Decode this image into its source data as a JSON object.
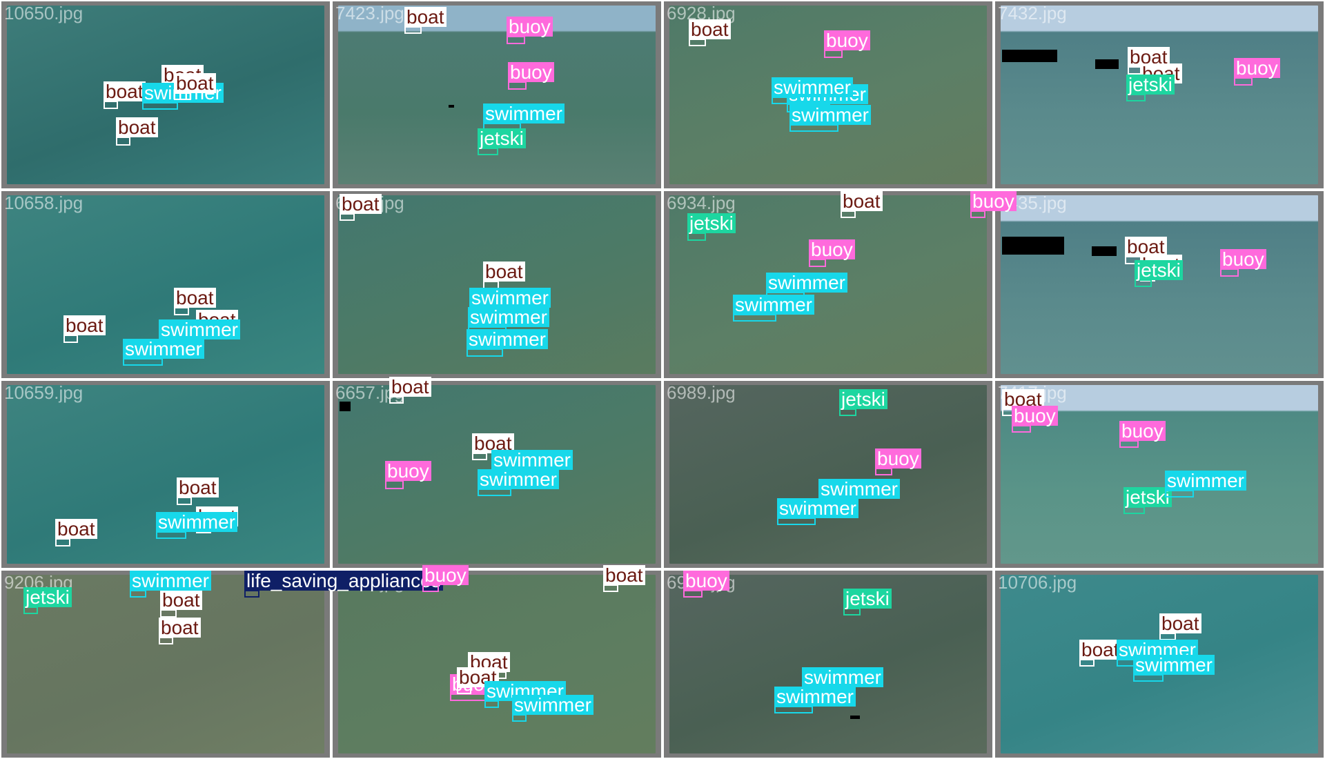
{
  "classes": {
    "boat": {
      "bg": "#ffffff",
      "fg": "#6b1a12"
    },
    "buoy": {
      "bg": "#ff6adc",
      "fg": "#ffffff"
    },
    "swimmer": {
      "bg": "#17d8ea",
      "fg": "#ffffff"
    },
    "jetski": {
      "bg": "#1dd6a0",
      "fg": "#ffffff"
    },
    "life_saving_appliances": {
      "bg": "#0f1f66",
      "fg": "#ffffff"
    }
  },
  "tiles": [
    {
      "name": "10650.jpg",
      "water": [
        "#3e7d7a",
        "#2f6d6c",
        "#3a7e7c"
      ],
      "sky": "",
      "frame": "#7a7a7a",
      "detections": [
        {
          "cls": "boat",
          "label": "boat"
        },
        {
          "cls": "boat",
          "label": "boat"
        },
        {
          "cls": "swimmer",
          "label": "swimmer"
        },
        {
          "cls": "boat",
          "label": "boat"
        },
        {
          "cls": "boat",
          "label": "boat"
        }
      ]
    },
    {
      "name": "7423.jpg",
      "water": [
        "#4d7b73",
        "#4a7a6b",
        "#5a8073"
      ],
      "sky": "#8fb3c8",
      "frame": "#7a7a7a",
      "detections": [
        {
          "cls": "boat",
          "label": "boat"
        },
        {
          "cls": "buoy",
          "label": "buoy"
        },
        {
          "cls": "buoy",
          "label": "buoy"
        },
        {
          "cls": "swimmer",
          "label": "swimmer"
        },
        {
          "cls": "jetski",
          "label": "jetski"
        }
      ]
    },
    {
      "name": "6928.jpg",
      "water": [
        "#4f7a68",
        "#5c7f66",
        "#647c5e"
      ],
      "sky": "",
      "frame": "#7a7a7a",
      "detections": [
        {
          "cls": "boat",
          "label": "boat"
        },
        {
          "cls": "buoy",
          "label": "buoy"
        },
        {
          "cls": "swimmer",
          "label": "swimmer"
        },
        {
          "cls": "swimmer",
          "label": "swimmer"
        },
        {
          "cls": "swimmer",
          "label": "swimmer"
        }
      ]
    },
    {
      "name": "7432.jpg",
      "water": [
        "#4f7f86",
        "#5a8a8c",
        "#61908f"
      ],
      "sky": "#b7cde0",
      "frame": "#7a7a7a",
      "detections": [
        {
          "cls": "boat",
          "label": "boat"
        },
        {
          "cls": "boat",
          "label": "boat"
        },
        {
          "cls": "jetski",
          "label": "jetski"
        },
        {
          "cls": "buoy",
          "label": "buoy"
        }
      ]
    },
    {
      "name": "10658.jpg",
      "water": [
        "#3e8480",
        "#2f7a78",
        "#3a8680"
      ],
      "sky": "",
      "frame": "#7a7a7a",
      "detections": [
        {
          "cls": "boat",
          "label": "boat"
        },
        {
          "cls": "boat",
          "label": "boat"
        },
        {
          "cls": "boat",
          "label": "boat"
        },
        {
          "cls": "swimmer",
          "label": "swimmer"
        },
        {
          "cls": "swimmer",
          "label": "swimmer"
        }
      ]
    },
    {
      "name": "6634.jpg",
      "water": [
        "#43786f",
        "#4d7a66",
        "#5a7b5f"
      ],
      "sky": "",
      "frame": "#7a7a7a",
      "detections": [
        {
          "cls": "boat",
          "label": "boat"
        },
        {
          "cls": "boat",
          "label": "boat"
        },
        {
          "cls": "swimmer",
          "label": "swimmer"
        },
        {
          "cls": "swimmer",
          "label": "swimmer"
        },
        {
          "cls": "swimmer",
          "label": "swimmer"
        }
      ]
    },
    {
      "name": "6934.jpg",
      "water": [
        "#4f7a68",
        "#5c7f66",
        "#647c5e"
      ],
      "sky": "",
      "frame": "#7a7a7a",
      "detections": [
        {
          "cls": "jetski",
          "label": "jetski"
        },
        {
          "cls": "buoy",
          "label": "buoy"
        },
        {
          "cls": "swimmer",
          "label": "swimmer"
        },
        {
          "cls": "swimmer",
          "label": "swimmer"
        },
        {
          "cls": "boat",
          "label": "boat"
        },
        {
          "cls": "buoy",
          "label": "buoy"
        }
      ]
    },
    {
      "name": "7435.jpg",
      "water": [
        "#4f7f86",
        "#5a8a8c",
        "#61908f"
      ],
      "sky": "#b7cde0",
      "frame": "#7a7a7a",
      "detections": [
        {
          "cls": "boat",
          "label": "boat"
        },
        {
          "cls": "boat",
          "label": "boat"
        },
        {
          "cls": "jetski",
          "label": "jetski"
        },
        {
          "cls": "buoy",
          "label": "buoy"
        }
      ]
    },
    {
      "name": "10659.jpg",
      "water": [
        "#3e8480",
        "#2f7a78",
        "#3a8680"
      ],
      "sky": "",
      "frame": "#7a7a7a",
      "detections": [
        {
          "cls": "boat",
          "label": "boat"
        },
        {
          "cls": "boat",
          "label": "boat"
        },
        {
          "cls": "boat",
          "label": "boat"
        },
        {
          "cls": "swimmer",
          "label": "swimmer"
        }
      ]
    },
    {
      "name": "6657.jpg",
      "water": [
        "#43786f",
        "#4d7a66",
        "#5a7b5f"
      ],
      "sky": "",
      "frame": "#7a7a7a",
      "detections": [
        {
          "cls": "boat",
          "label": "boat"
        },
        {
          "cls": "boat",
          "label": "boat"
        },
        {
          "cls": "buoy",
          "label": "buoy"
        },
        {
          "cls": "swimmer",
          "label": "swimmer"
        },
        {
          "cls": "swimmer",
          "label": "swimmer"
        }
      ]
    },
    {
      "name": "6989.jpg",
      "water": [
        "#55665f",
        "#4a6053",
        "#5a6b5c"
      ],
      "sky": "",
      "frame": "#7a7a7a",
      "detections": [
        {
          "cls": "jetski",
          "label": "jetski"
        },
        {
          "cls": "buoy",
          "label": "buoy"
        },
        {
          "cls": "swimmer",
          "label": "swimmer"
        },
        {
          "cls": "swimmer",
          "label": "swimmer"
        }
      ]
    },
    {
      "name": "7417.jpg",
      "water": [
        "#4e8a84",
        "#5a9488",
        "#62978b"
      ],
      "sky": "#b7cde0",
      "frame": "#7a7a7a",
      "detections": [
        {
          "cls": "boat",
          "label": "boat"
        },
        {
          "cls": "buoy",
          "label": "buoy"
        },
        {
          "cls": "buoy",
          "label": "buoy"
        },
        {
          "cls": "jetski",
          "label": "jetski"
        },
        {
          "cls": "swimmer",
          "label": "swimmer"
        }
      ]
    },
    {
      "name": "9206.jpg",
      "water": [
        "#6a7a62",
        "#667560",
        "#6f7e64"
      ],
      "sky": "",
      "frame": "#7a7a7a",
      "detections": [
        {
          "cls": "boat",
          "label": "boat"
        },
        {
          "cls": "jetski",
          "label": "jetski"
        },
        {
          "cls": "swimmer",
          "label": "swimmer"
        },
        {
          "cls": "life_saving_appliances",
          "label": "life_saving_appliances"
        },
        {
          "cls": "boat",
          "label": "boat"
        }
      ]
    },
    {
      "name": "6675.jpg",
      "water": [
        "#58795f",
        "#5d7d60",
        "#637d5e"
      ],
      "sky": "",
      "frame": "#7a7a7a",
      "detections": [
        {
          "cls": "buoy",
          "label": "buoy"
        },
        {
          "cls": "boat",
          "label": "boat"
        },
        {
          "cls": "boat",
          "label": "boat"
        },
        {
          "cls": "buoy",
          "label": "buoy"
        },
        {
          "cls": "boat",
          "label": "boat"
        },
        {
          "cls": "swimmer",
          "label": "swimmer"
        },
        {
          "cls": "swimmer",
          "label": "swimmer"
        }
      ]
    },
    {
      "name": "6996.jpg",
      "water": [
        "#55665f",
        "#4a6053",
        "#5a6b5c"
      ],
      "sky": "",
      "frame": "#7a7a7a",
      "detections": [
        {
          "cls": "jetski",
          "label": "jetski"
        },
        {
          "cls": "buoy",
          "label": "buoy"
        },
        {
          "cls": "swimmer",
          "label": "swimmer"
        },
        {
          "cls": "swimmer",
          "label": "swimmer"
        }
      ]
    },
    {
      "name": "10706.jpg",
      "water": [
        "#3e8a8c",
        "#358486",
        "#4a9092"
      ],
      "sky": "",
      "frame": "#7a7a7a",
      "detections": [
        {
          "cls": "boat",
          "label": "boat"
        },
        {
          "cls": "boat",
          "label": "boat"
        },
        {
          "cls": "swimmer",
          "label": "swimmer"
        },
        {
          "cls": "swimmer",
          "label": "swimmer"
        }
      ]
    }
  ]
}
